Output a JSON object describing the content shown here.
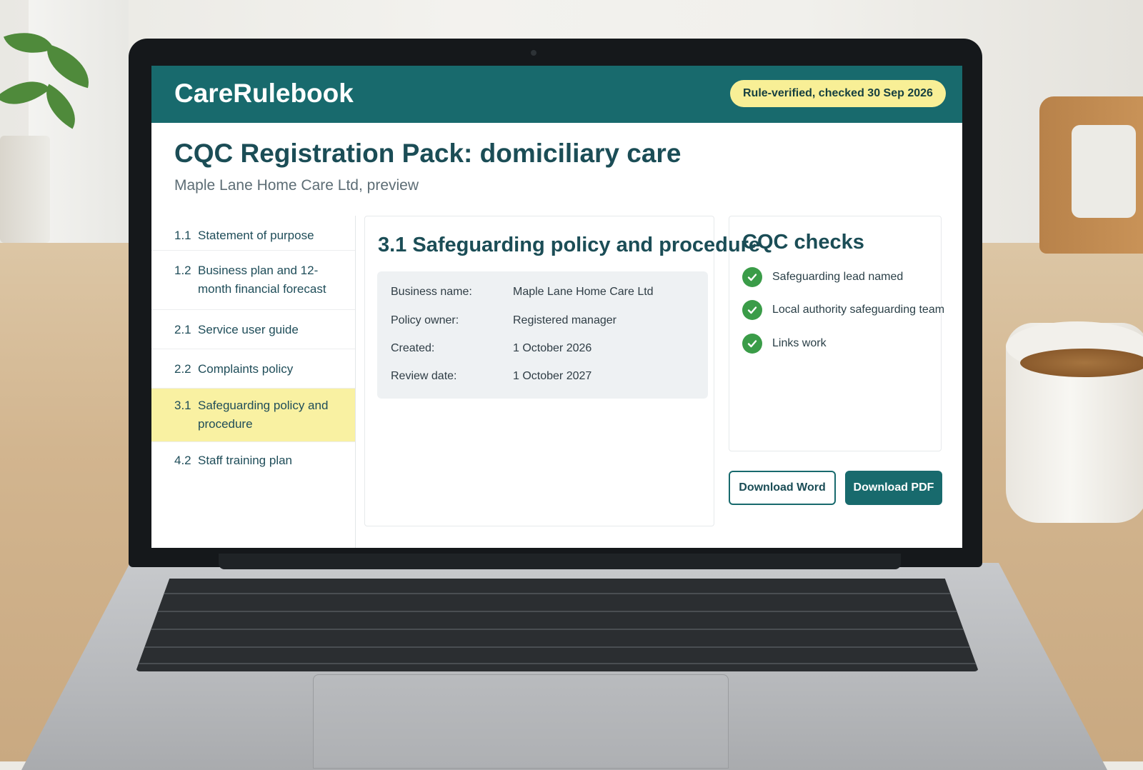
{
  "header": {
    "brand": "CareRulebook",
    "verified_badge": "Rule-verified, checked 30 Sep 2026"
  },
  "page": {
    "title": "CQC Registration Pack: domiciliary care",
    "subtitle": "Maple Lane Home Care Ltd, preview"
  },
  "toc": {
    "items": [
      {
        "num": "1.1",
        "label": "Statement of purpose"
      },
      {
        "num": "1.2",
        "label": "Business plan and 12-month financial forecast"
      },
      {
        "num": "2.1",
        "label": "Service user guide"
      },
      {
        "num": "2.2",
        "label": "Complaints policy"
      },
      {
        "num": "3.1",
        "label": "Safeguarding policy and procedure",
        "active": true
      },
      {
        "num": "4.2",
        "label": "Staff training plan"
      }
    ]
  },
  "section": {
    "title": "3.1 Safeguarding policy and procedure",
    "fields": [
      {
        "key": "Business name:",
        "value": "Maple Lane Home Care Ltd"
      },
      {
        "key": "Policy owner:",
        "value": "Registered manager"
      },
      {
        "key": "Created:",
        "value": "1 October 2026"
      },
      {
        "key": "Review date:",
        "value": "1 October 2027"
      }
    ]
  },
  "checks": {
    "title": "CQC checks",
    "items": [
      {
        "label": "Safeguarding lead named",
        "icon": "check-circle-icon"
      },
      {
        "label": "Local authority safeguarding team",
        "icon": "check-circle-icon"
      },
      {
        "label": "Links work",
        "icon": "check-circle-icon"
      }
    ]
  },
  "actions": {
    "download_word": "Download Word",
    "download_pdf": "Download PDF"
  },
  "colors": {
    "brand": "#186a6d",
    "badge": "#f8ef96",
    "active_item": "#f9f1a2",
    "check": "#3a9c48"
  }
}
